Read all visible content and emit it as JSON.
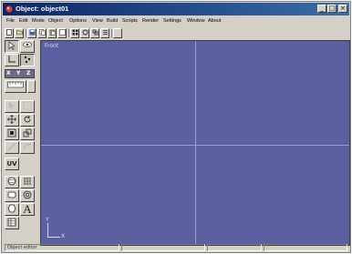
{
  "window": {
    "title": "Object: object01",
    "controls": {
      "minimize": "_",
      "maximize": "□",
      "close": "×"
    }
  },
  "menu": [
    "File",
    "Edit",
    "Mode",
    "Object",
    "Options",
    "View",
    "Build",
    "Scripts",
    "Render",
    "Settings",
    "Window",
    "About"
  ],
  "toolbar": {
    "icons": [
      "new-icon",
      "open-icon",
      "save-icon",
      "copy-icon",
      "paste-icon",
      "view-icon",
      "grid-icon",
      "rotate-icon",
      "scale-icon",
      "list-icon",
      "blank-icon"
    ]
  },
  "tools": {
    "axes": {
      "x": "X",
      "y": "Y",
      "z": "Z"
    },
    "uv": "UV",
    "text": "A"
  },
  "viewport": {
    "label": "Front",
    "axis_y": "Y",
    "axis_x": "X",
    "background": "#5b5fa3"
  },
  "status": {
    "message": "Object editor"
  }
}
